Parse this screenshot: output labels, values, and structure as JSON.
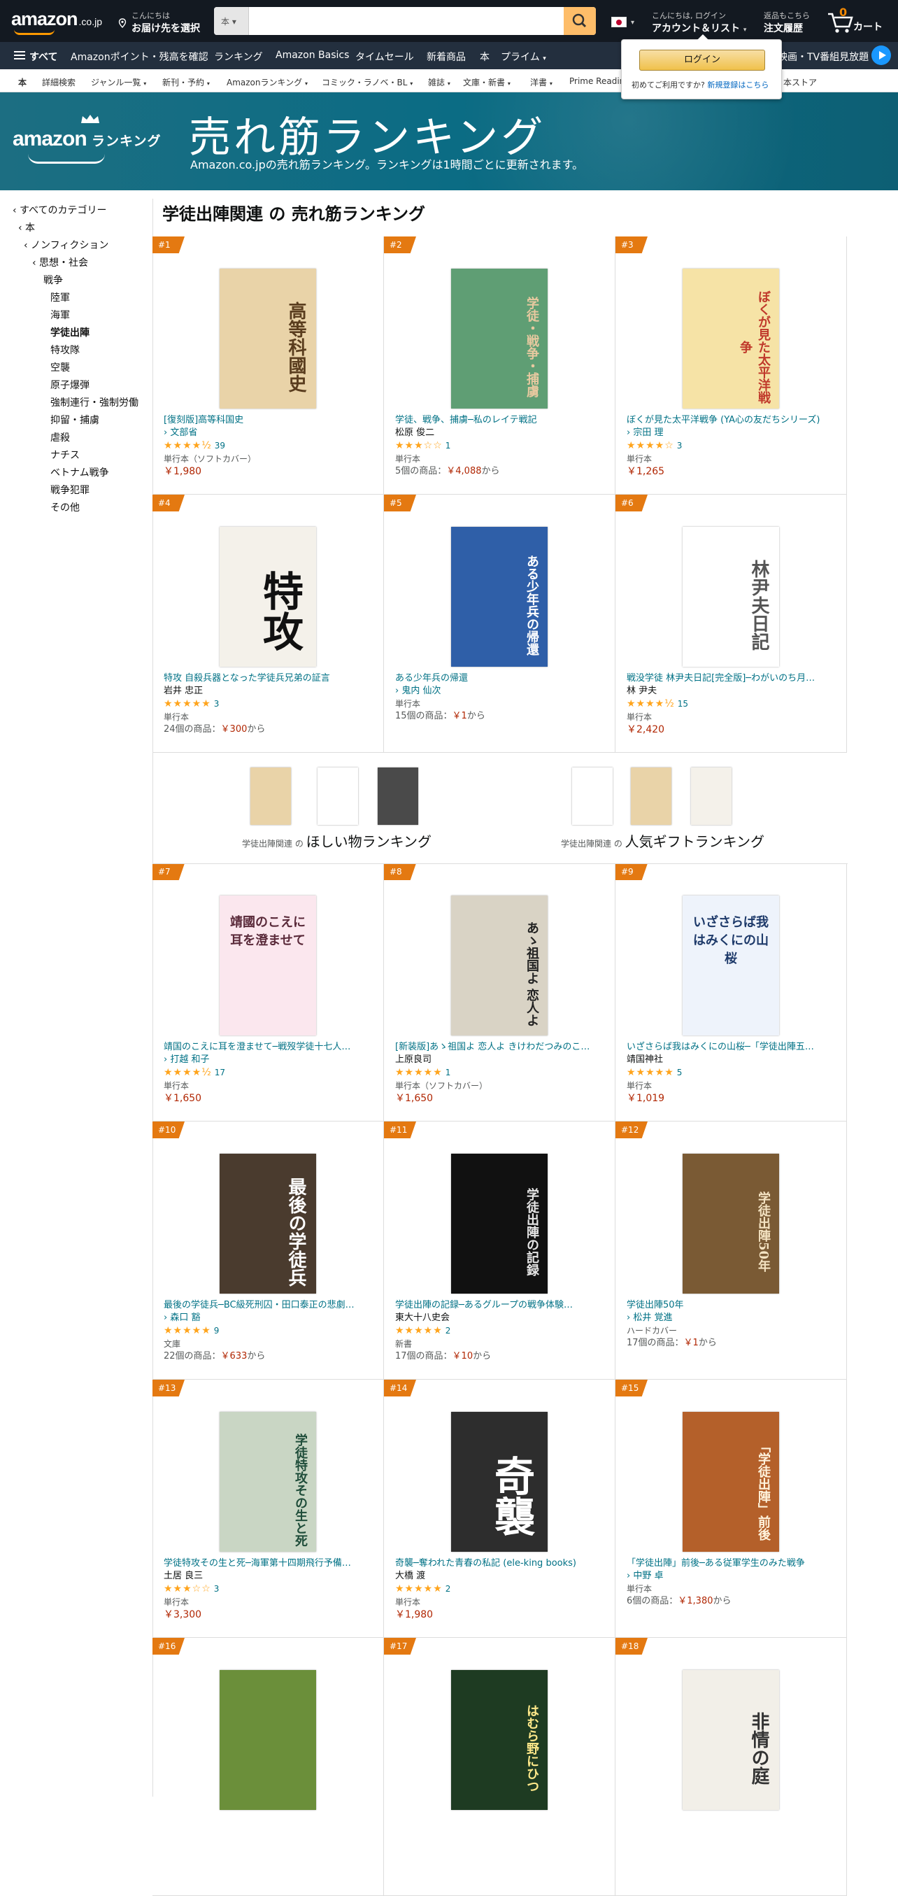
{
  "header": {
    "logo": "amazon",
    "logo_suffix": ".co.jp",
    "deliver_line1": "こんにちは",
    "deliver_line2": "お届け先を選択",
    "search_category": "本",
    "search_placeholder": "",
    "account_line1": "こんにちは, ログイン",
    "account_line2": "アカウント＆リスト",
    "orders_line1": "返品もこちら",
    "orders_line2": "注文履歴",
    "cart_count": "0",
    "cart_label": "カート"
  },
  "navbar": {
    "all": "すべて",
    "items": [
      "Amazonポイント・残高を確認",
      "ランキング",
      "Amazon Basics",
      "タイムセール",
      "新着商品",
      "本",
      "プライム"
    ],
    "right": "映画・TV番組見放題"
  },
  "subnav": {
    "items": [
      "本",
      "詳細検索",
      "ジャンル一覧",
      "新刊・予約",
      "Amazonランキング",
      "コミック・ラノベ・BL",
      "雑誌",
      "文庫・新書",
      "洋書",
      "Prime Readin",
      "本ストア"
    ]
  },
  "popover": {
    "login": "ログイン",
    "first_time": "初めてご利用ですか?",
    "register": "新規登録はこちら"
  },
  "banner": {
    "logo": "amazon",
    "logo_suffix": "ランキング",
    "title": "売れ筋ランキング",
    "subtitle": "Amazon.co.jpの売れ筋ランキング。ランキングは1時間ごとに更新されます。"
  },
  "sidebar": {
    "items": [
      "‹ すべてのカテゴリー",
      "‹ 本",
      "‹ ノンフィクション",
      "‹ 思想・社会",
      "戦争",
      "陸軍",
      "海軍",
      "学徒出陣",
      "特攻隊",
      "空襲",
      "原子爆弾",
      "強制連行・強制労働",
      "抑留・捕虜",
      "虐殺",
      "ナチス",
      "ベトナム戦争",
      "戦争犯罪",
      "その他"
    ],
    "selected": "学徒出陣"
  },
  "page_title": "学徒出陣関連 の 売れ筋ランキング",
  "promo": {
    "left_prefix": "学徒出陣関連 の",
    "left_label": "ほしい物ランキング",
    "right_prefix": "学徒出陣関連 の",
    "right_label": "人気ギフトランキング"
  },
  "products": [
    {
      "rank": "#1",
      "title": "[復刻版]高等科国史",
      "author": "文部省",
      "author_link": true,
      "stars": "★★★★½",
      "reviews": "39",
      "format": "単行本（ソフトカバー）",
      "price": "￥1,980",
      "offers": "",
      "offers_price": "",
      "offers_suffix": "",
      "cover": "高等科國史",
      "bg": "#e9d3a8",
      "fg": "#5a3d1e"
    },
    {
      "rank": "#2",
      "title": "学徒、戦争、捕虜─私のレイテ戦記",
      "author": "松原 俊二",
      "author_link": false,
      "stars": "★★★☆☆",
      "reviews": "1",
      "format": "単行本",
      "price": "",
      "offers": "5個の商品：",
      "offers_price": "￥4,088",
      "offers_suffix": "から",
      "cover": "学徒・戦争・捕虜",
      "bg": "#5f9e74",
      "fg": "#e8c9a0"
    },
    {
      "rank": "#3",
      "title": "ぼくが見た太平洋戦争 (YA心の友だちシリーズ)",
      "author": "宗田 理",
      "author_link": true,
      "stars": "★★★★☆",
      "reviews": "3",
      "format": "単行本",
      "price": "￥1,265",
      "offers": "",
      "offers_price": "",
      "offers_suffix": "",
      "cover": "ぼくが見た太平洋戦争",
      "bg": "#f6e3a6",
      "fg": "#c0392b"
    },
    {
      "rank": "#4",
      "title": "特攻 自殺兵器となった学徒兵兄弟の証言",
      "author": "岩井 忠正",
      "author_link": false,
      "stars": "★★★★★",
      "reviews": "3",
      "format": "単行本",
      "price": "",
      "offers": "24個の商品：",
      "offers_price": "￥300",
      "offers_suffix": "から",
      "cover": "特攻",
      "bg": "#f4f1ea",
      "fg": "#111111"
    },
    {
      "rank": "#5",
      "title": "ある少年兵の帰還",
      "author": "鬼内 仙次",
      "author_link": true,
      "stars": "",
      "reviews": "",
      "format": "単行本",
      "price": "",
      "offers": "15個の商品：",
      "offers_price": "￥1",
      "offers_suffix": "から",
      "cover": "ある少年兵の帰還",
      "bg": "#2f5fa8",
      "fg": "#ffffff"
    },
    {
      "rank": "#6",
      "title": "戦没学徒 林尹夫日記[完全版]─わがいのち月…",
      "author": "林 尹夫",
      "author_link": false,
      "stars": "★★★★½",
      "reviews": "15",
      "format": "単行本",
      "price": "￥2,420",
      "offers": "",
      "offers_price": "",
      "offers_suffix": "",
      "cover": "林尹夫日記",
      "bg": "#ffffff",
      "fg": "#555555"
    },
    {
      "rank": "#7",
      "title": "靖国のこえに耳を澄ませて─戦歿学徒十七人…",
      "author": "打越 和子",
      "author_link": true,
      "stars": "★★★★½",
      "reviews": "17",
      "format": "単行本",
      "price": "￥1,650",
      "offers": "",
      "offers_price": "",
      "offers_suffix": "",
      "cover": "靖國のこえに耳を澄ませて",
      "bg": "#fbe7ee",
      "fg": "#5a2a3a"
    },
    {
      "rank": "#8",
      "title": "[新装版]あゝ祖国よ 恋人よ きけわだつみのこ…",
      "author": "上原良司",
      "author_link": false,
      "stars": "★★★★★",
      "reviews": "1",
      "format": "単行本（ソフトカバー）",
      "price": "￥1,650",
      "offers": "",
      "offers_price": "",
      "offers_suffix": "",
      "cover": "あゝ祖国よ 恋人よ",
      "bg": "#d9d3c5",
      "fg": "#222222"
    },
    {
      "rank": "#9",
      "title": "いざさらば我はみくにの山桜─「学徒出陣五…",
      "author": "靖国神社",
      "author_link": false,
      "stars": "★★★★★",
      "reviews": "5",
      "format": "単行本",
      "price": "￥1,019",
      "offers": "",
      "offers_price": "",
      "offers_suffix": "",
      "cover": "いざさらば我はみくにの山桜",
      "bg": "#eef3fb",
      "fg": "#1e3a6a"
    },
    {
      "rank": "#10",
      "title": "最後の学徒兵─BC級死刑囚・田口泰正の悲劇…",
      "author": "森口 豁",
      "author_link": true,
      "stars": "★★★★★",
      "reviews": "9",
      "format": "文庫",
      "price": "",
      "offers": "22個の商品：",
      "offers_price": "￥633",
      "offers_suffix": "から",
      "cover": "最後の学徒兵",
      "bg": "#4a3b2e",
      "fg": "#ffffff"
    },
    {
      "rank": "#11",
      "title": "学徒出陣の記録─あるグループの戦争体験…",
      "author": "東大十八史会",
      "author_link": false,
      "stars": "★★★★★",
      "reviews": "2",
      "format": "新書",
      "price": "",
      "offers": "17個の商品：",
      "offers_price": "￥10",
      "offers_suffix": "から",
      "cover": "学徒出陣の記録",
      "bg": "#111111",
      "fg": "#e6e6e6"
    },
    {
      "rank": "#12",
      "title": "学徒出陣50年",
      "author": "松井 覚進",
      "author_link": true,
      "stars": "",
      "reviews": "",
      "format": "ハードカバー",
      "price": "",
      "offers": "17個の商品：",
      "offers_price": "￥1",
      "offers_suffix": "から",
      "cover": "学徒出陣50年",
      "bg": "#7a5a34",
      "fg": "#f4e3c2"
    },
    {
      "rank": "#13",
      "title": "学徒特攻その生と死─海軍第十四期飛行予備…",
      "author": "土居 良三",
      "author_link": false,
      "stars": "★★★☆☆",
      "reviews": "3",
      "format": "単行本",
      "price": "￥3,300",
      "offers": "",
      "offers_price": "",
      "offers_suffix": "",
      "cover": "学徒特攻その生と死",
      "bg": "#c9d6c4",
      "fg": "#1f4d3a"
    },
    {
      "rank": "#14",
      "title": "奇襲─奪われた青春の私記 (ele-king books)",
      "author": "大橋 渡",
      "author_link": false,
      "stars": "★★★★★",
      "reviews": "2",
      "format": "単行本",
      "price": "￥1,980",
      "offers": "",
      "offers_price": "",
      "offers_suffix": "",
      "cover": "奇襲",
      "bg": "#2d2d2d",
      "fg": "#ffffff"
    },
    {
      "rank": "#15",
      "title": "「学徒出陣」前後─ある従軍学生のみた戦争",
      "author": "中野 卓",
      "author_link": true,
      "stars": "",
      "reviews": "",
      "format": "単行本",
      "price": "",
      "offers": "6個の商品：",
      "offers_price": "￥1,380",
      "offers_suffix": "から",
      "cover": "「学徒出陣」前後",
      "bg": "#b4602a",
      "fg": "#fff3dc"
    },
    {
      "rank": "#16",
      "title": "",
      "author": "",
      "author_link": false,
      "stars": "",
      "reviews": "",
      "format": "",
      "price": "",
      "offers": "",
      "offers_price": "",
      "offers_suffix": "",
      "cover": "",
      "bg": "#6b8f3a",
      "fg": "#ffffff"
    },
    {
      "rank": "#17",
      "title": "",
      "author": "",
      "author_link": false,
      "stars": "",
      "reviews": "",
      "format": "",
      "price": "",
      "offers": "",
      "offers_price": "",
      "offers_suffix": "",
      "cover": "はむら野にひつ",
      "bg": "#1e3b22",
      "fg": "#ffe98a"
    },
    {
      "rank": "#18",
      "title": "",
      "author": "",
      "author_link": false,
      "stars": "",
      "reviews": "",
      "format": "",
      "price": "",
      "offers": "",
      "offers_price": "",
      "offers_suffix": "",
      "cover": "非情の庭",
      "bg": "#f2efe8",
      "fg": "#333333"
    }
  ],
  "colors": {
    "header": "#131921",
    "nav": "#232f3e",
    "badge": "#e47911",
    "banner": "#0b6c84",
    "link": "#007185",
    "price": "#b12704",
    "star": "#ffa41c"
  }
}
